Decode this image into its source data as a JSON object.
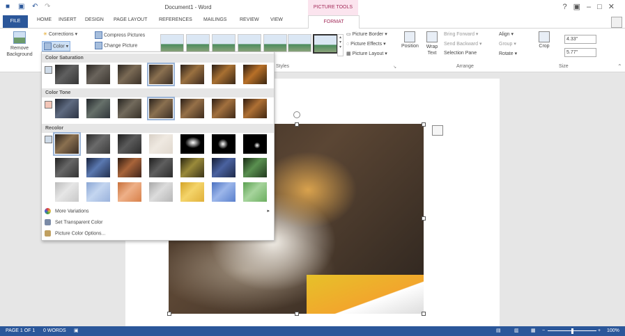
{
  "title_bar": {
    "document_title": "Document1 - Word",
    "context_title": "PICTURE TOOLS",
    "help": "?"
  },
  "tabs": [
    {
      "label": "FILE"
    },
    {
      "label": "HOME"
    },
    {
      "label": "INSERT"
    },
    {
      "label": "DESIGN"
    },
    {
      "label": "PAGE LAYOUT"
    },
    {
      "label": "REFERENCES"
    },
    {
      "label": "MAILINGS"
    },
    {
      "label": "REVIEW"
    },
    {
      "label": "VIEW"
    },
    {
      "label": "FORMAT"
    }
  ],
  "ribbon": {
    "remove_background": "Remove Background",
    "corrections": "Corrections",
    "color": "Color",
    "compress": "Compress Pictures",
    "change": "Change Picture",
    "styles_label": "Styles",
    "picture_border": "Picture Border",
    "picture_effects": "Picture Effects",
    "picture_layout": "Picture Layout",
    "position": "Position",
    "wrap_text": "Wrap Text",
    "bring_forward": "Bring Forward",
    "send_backward": "Send Backward",
    "selection_pane": "Selection Pane",
    "align": "Align",
    "group": "Group",
    "rotate": "Rotate",
    "arrange_label": "Arrange",
    "crop": "Crop",
    "height": "4.33\"",
    "width": "5.77\"",
    "size_label": "Size"
  },
  "color_menu": {
    "saturation_title": "Color Saturation",
    "tone_title": "Color Tone",
    "recolor_title": "Recolor",
    "more_variations": "More Variations",
    "set_transparent": "Set Transparent Color",
    "color_options": "Picture Color Options..."
  },
  "status": {
    "page": "PAGE 1 OF 1",
    "words": "0 WORDS",
    "zoom": "100%"
  },
  "colors": {
    "accent": "#2b579a",
    "context": "#a32c5a"
  }
}
